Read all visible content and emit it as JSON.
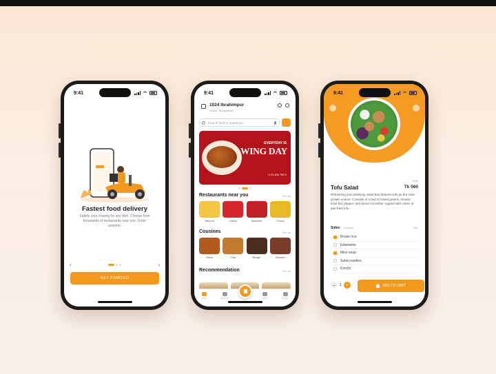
{
  "status": {
    "time": "9:41"
  },
  "onboarding": {
    "title": "Fastest food delivery",
    "description": "Satisfy your craving for any dish. Choose from thousands of restaurants near you. Order anytime.",
    "cta": "GET STARTED",
    "prev": "‹",
    "next": "›"
  },
  "home": {
    "location_name": "1024 Ibrahimpur",
    "location_sub": "Dhaka, Bangladesh",
    "search_placeholder": "Search food or restaurant",
    "banner": {
      "eyebrow": "EVERYDAY IS",
      "title": "WING DAY",
      "phone": "+123 456 789 0"
    },
    "sections": {
      "restaurants": "Restaurants near you",
      "cuisines": "Cousines",
      "recommendation": "Recommendation",
      "see_all": "See all"
    },
    "restaurants": [
      {
        "name": "Takeout",
        "color": "#f4c542"
      },
      {
        "name": "Chillox",
        "color": "#d6262b"
      },
      {
        "name": "Madchef",
        "color": "#c21f26"
      },
      {
        "name": "Cheez",
        "color": "#e9b826"
      }
    ],
    "cuisines": [
      {
        "name": "Pizza",
        "color": "#b25a1e"
      },
      {
        "name": "Thai",
        "color": "#c27a2d"
      },
      {
        "name": "Burger",
        "color": "#4a2d1e"
      },
      {
        "name": "Dessert",
        "color": "#7a3b2a"
      }
    ],
    "tabs": [
      "Home",
      "Favourite",
      "",
      "Order",
      "Profile"
    ]
  },
  "detail": {
    "name": "Tofu Salad",
    "price_label": "Price",
    "price": "Tk 560",
    "description": "Refreshing and satisfying salad that features tofu as the main protein source. Consists of a bed of mixed greens, tomato, bowl fed, pepper, and sliced cucumber, topped with cubes of pan-fried tofu.",
    "sides_title": "Sides",
    "sides_req": "(Optional)",
    "sides_max": "Max",
    "sides": [
      {
        "name": "Brown rice",
        "checked": true
      },
      {
        "name": "Edamame",
        "checked": false
      },
      {
        "name": "Miso soup",
        "checked": true
      },
      {
        "name": "Soba noodles",
        "checked": false
      },
      {
        "name": "Kimchi",
        "checked": false
      }
    ],
    "quantity": "1",
    "minus": "–",
    "plus": "+",
    "add_to_cart": "ADD TO CART"
  }
}
